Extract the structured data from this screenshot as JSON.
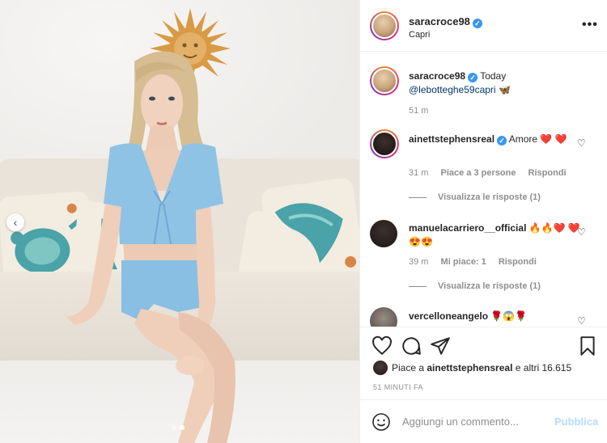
{
  "post": {
    "username": "saracroce98",
    "location": "Capri",
    "more_icon": "more-horizontal-icon"
  },
  "caption": {
    "username": "saracroce98",
    "time_label": "Today",
    "mention": "@lebotteghe59capri",
    "emoji": "🦋",
    "age": "51 m"
  },
  "comments": [
    {
      "username": "ainettstephensreal",
      "text": "Amore",
      "emoji": "❤️ ❤️",
      "age": "31 m",
      "likes": "Piace a 3 persone",
      "reply": "Rispondi",
      "view_replies": "Visualizza le risposte (1)"
    },
    {
      "username": "manuelacarriero__official",
      "text": "",
      "emoji": "🔥🔥❤️ ❤️😍😍",
      "age": "39 m",
      "likes": "Mi piace: 1",
      "reply": "Rispondi",
      "view_replies": "Visualizza le risposte (1)"
    },
    {
      "username": "vercelloneangelo",
      "text": "",
      "emoji": "🌹😱🌹"
    }
  ],
  "likes": {
    "prefix": "Piace a",
    "user": "ainettstephensreal",
    "suffix": "e altri 16.615"
  },
  "time_ago": "51 MINUTI FA",
  "composer": {
    "placeholder": "Aggiungi un commento...",
    "publish": "Pubblica"
  },
  "colors": {
    "verified": "#3897f0",
    "publish_disabled": "#b3dbff",
    "muted": "#8e8e8e"
  }
}
